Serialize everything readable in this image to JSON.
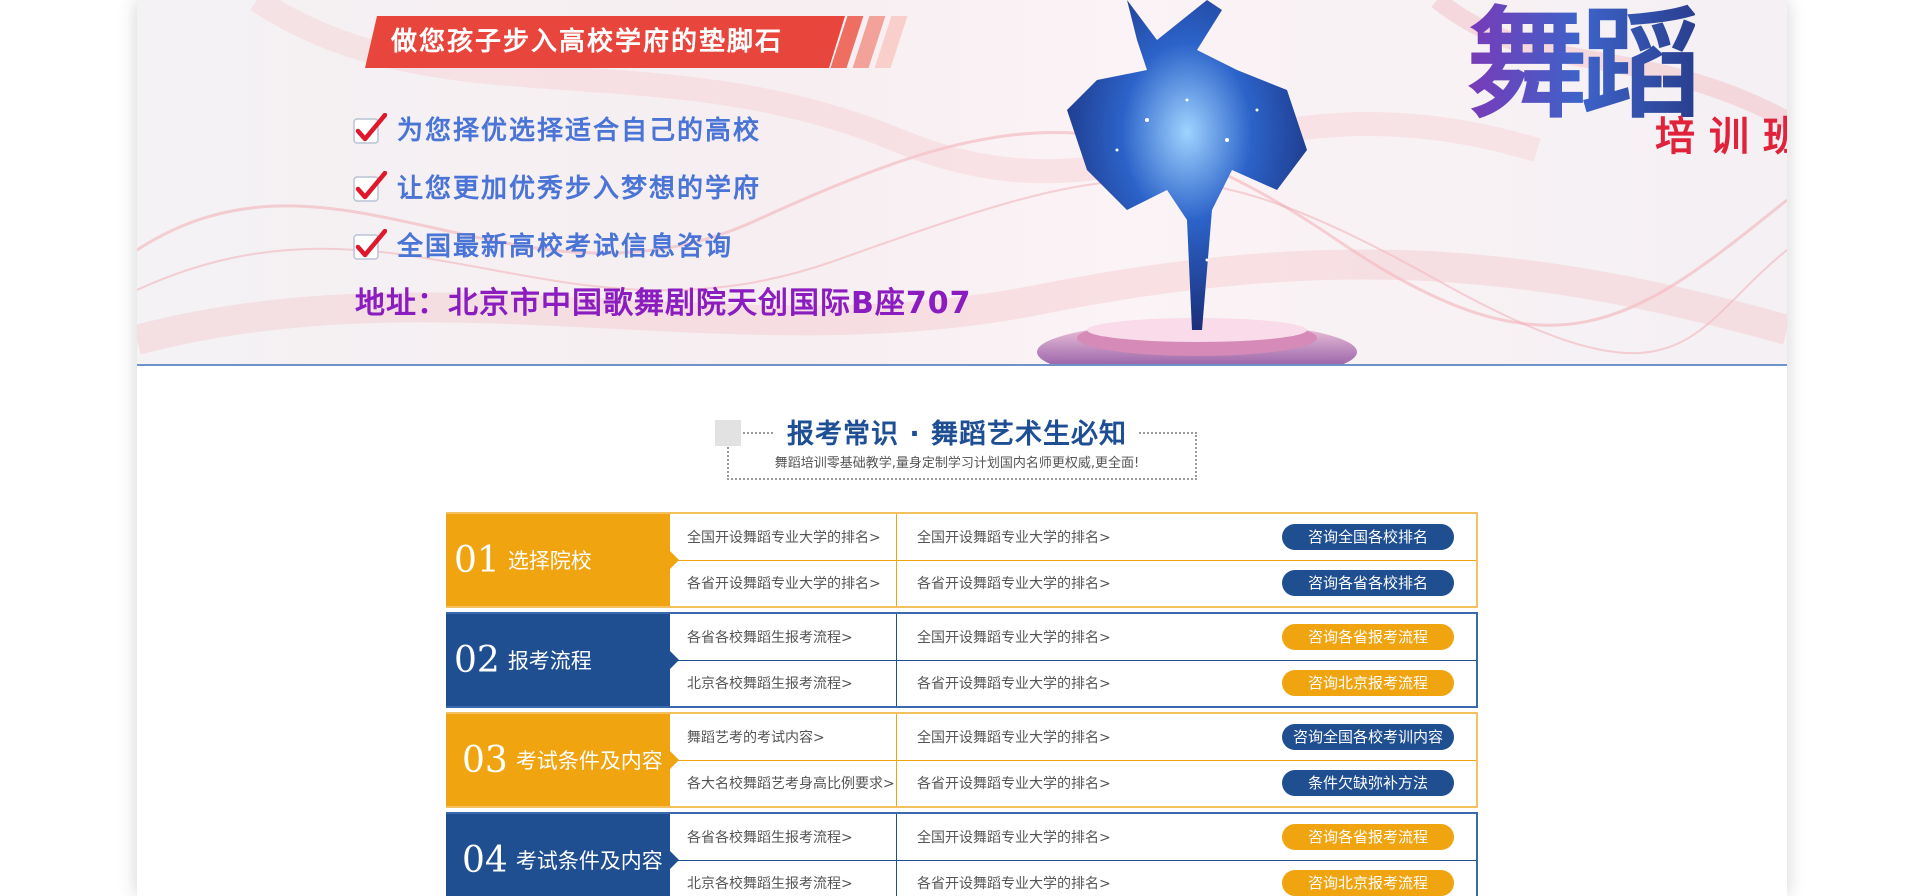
{
  "banner": {
    "slogan": "做您孩子步入高校学府的垫脚石",
    "checks": [
      "为您择优选择适合自己的高校",
      "让您更加优秀步入梦想的学府",
      "全国最新高校考试信息咨询"
    ],
    "address": "地址：北京市中国歌舞剧院天创国际B座707",
    "title_art": "舞蹈",
    "title_sub": "培训班"
  },
  "section": {
    "title": "报考常识 · 舞蹈艺术生必知",
    "subtitle": "舞蹈培训零基础教学,量身定制学习计划国内名师更权威,更全面!"
  },
  "blocks": [
    {
      "num": "01",
      "name": "选择院校",
      "rows": [
        {
          "a": "全国开设舞蹈专业大学的排名>",
          "b": "全国开设舞蹈专业大学的排名>",
          "button": "咨询全国各校排名"
        },
        {
          "a": "各省开设舞蹈专业大学的排名>",
          "b": "各省开设舞蹈专业大学的排名>",
          "button": "咨询各省各校排名"
        }
      ]
    },
    {
      "num": "02",
      "name": "报考流程",
      "rows": [
        {
          "a": "各省各校舞蹈生报考流程>",
          "b": "全国开设舞蹈专业大学的排名>",
          "button": "咨询各省报考流程"
        },
        {
          "a": "北京各校舞蹈生报考流程>",
          "b": "各省开设舞蹈专业大学的排名>",
          "button": "咨询北京报考流程"
        }
      ]
    },
    {
      "num": "03",
      "name": "考试条件及内容",
      "rows": [
        {
          "a": "舞蹈艺考的考试内容>",
          "b": "全国开设舞蹈专业大学的排名>",
          "button": "咨询全国各校考训内容"
        },
        {
          "a": "各大名校舞蹈艺考身高比例要求>",
          "b": "各省开设舞蹈专业大学的排名>",
          "button": "条件欠缺弥补方法"
        }
      ]
    },
    {
      "num": "04",
      "name": "考试条件及内容",
      "rows": [
        {
          "a": "各省各校舞蹈生报考流程>",
          "b": "全国开设舞蹈专业大学的排名>",
          "button": "咨询各省报考流程"
        },
        {
          "a": "北京各校舞蹈生报考流程>",
          "b": "各省开设舞蹈专业大学的排名>",
          "button": "咨询北京报考流程"
        }
      ]
    }
  ],
  "colors": {
    "orange": "#f0a410",
    "blue": "#1f4f91",
    "slogan_red": "#e8453c",
    "check_text": "#4a74d6",
    "address": "#8a1cc0"
  },
  "icons": [
    "check-icon",
    "dancer-silhouette",
    "heading-square"
  ]
}
